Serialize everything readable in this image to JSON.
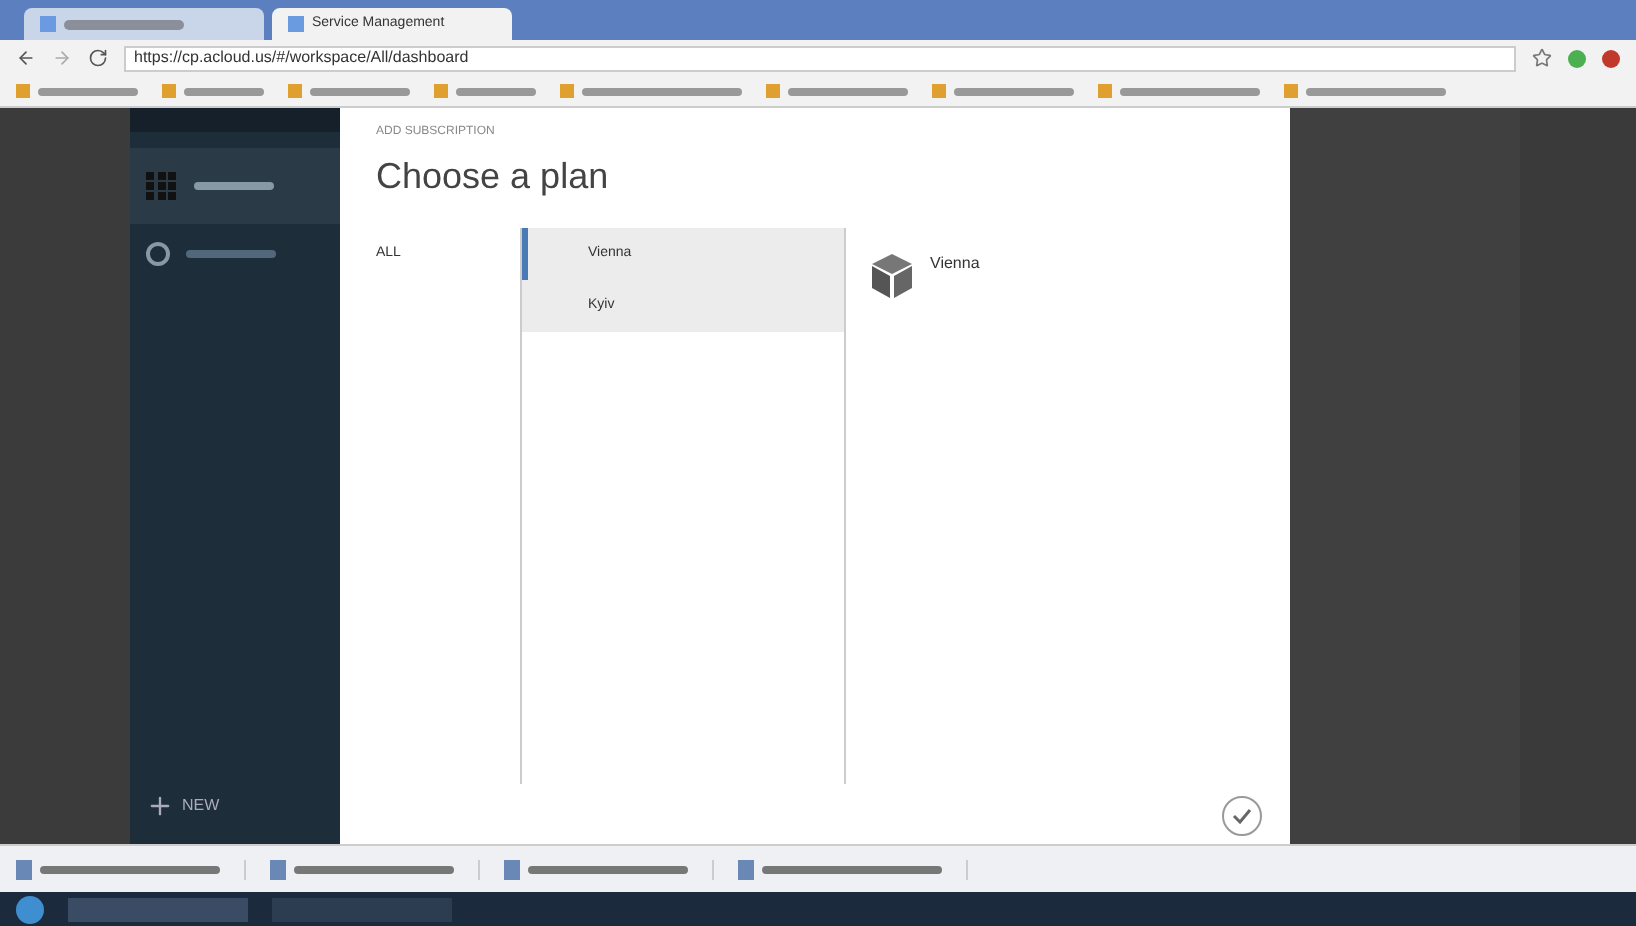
{
  "browser": {
    "tabs": [
      {
        "selected": false
      },
      {
        "title": "Service Management",
        "selected": true
      }
    ],
    "url": "https://cp.acloud.us/#/workspace/All/dashboard"
  },
  "sidebar": {
    "new_button": "NEW"
  },
  "dialog": {
    "kicker": "ADD SUBSCRIPTION",
    "title": "Choose a plan",
    "filters": [
      {
        "label": "ALL",
        "selected": true
      }
    ],
    "plans": [
      {
        "name": "Vienna",
        "selected": true
      },
      {
        "name": "Kyiv",
        "selected": false
      }
    ],
    "detail": {
      "name": "Vienna"
    }
  }
}
